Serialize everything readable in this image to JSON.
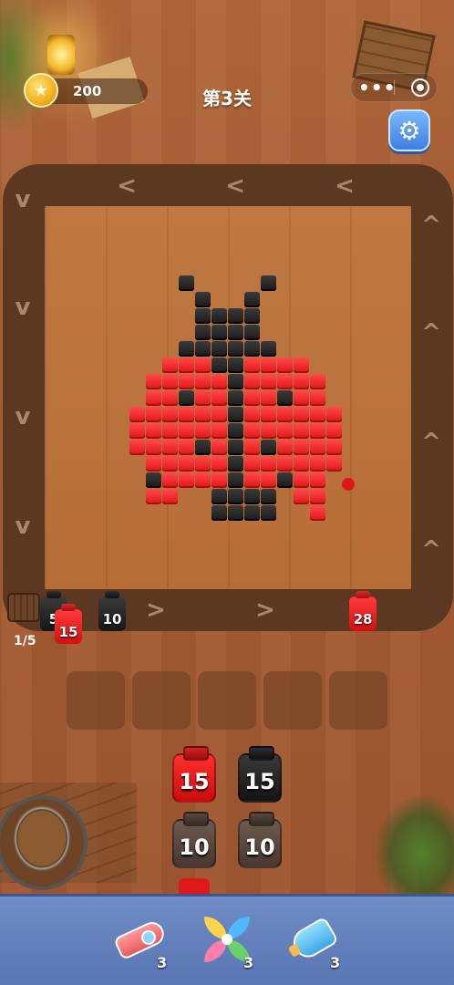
{
  "header": {
    "coins": "200",
    "level_title": "第3关",
    "more_label": "•••",
    "settings_icon": "⚙"
  },
  "conveyor": {
    "counter": "1/5",
    "jars_on_track": [
      {
        "value": "5",
        "color": "black"
      },
      {
        "value": "15",
        "color": "red"
      },
      {
        "value": "10",
        "color": "black"
      },
      {
        "value": "28",
        "color": "red"
      }
    ],
    "arrow_left": "<",
    "arrow_right": ">",
    "arrow_up": "^",
    "arrow_down": "v"
  },
  "empty_slots": 5,
  "queue": [
    {
      "value": "15",
      "color": "red"
    },
    {
      "value": "15",
      "color": "black"
    },
    {
      "value": "10",
      "color": "brown"
    },
    {
      "value": "10",
      "color": "brown"
    }
  ],
  "tools": [
    {
      "name": "rocket",
      "count": "3"
    },
    {
      "name": "pinwheel",
      "count": "3"
    },
    {
      "name": "bottle",
      "count": "3"
    }
  ],
  "colors": {
    "red": "#e01515",
    "black": "#1a1a1a",
    "board": "#b66d38",
    "track": "#5c3722",
    "bottom_bar": "#6f8cc6"
  },
  "ladybug_pattern": {
    "cols": 15,
    "rows": 15,
    "legend": {
      "r": "red",
      "b": "black",
      ".": "empty"
    },
    "rows_data": [
      "....b....b.....",
      ".....b..b......",
      ".....bbbb......",
      ".....bbbb......",
      "....bbbbbb.....",
      "...rrrbbrrrr...",
      "..rrrrrbrrrrr..",
      "..rrbrrbrrbrr..",
      ".rrrrrrbrrrrrr.",
      ".rrrrrrbrrrrrr.",
      ".rrrrbrbrbrrrr.",
      "..rrrrrbrrrrrr.",
      "..brrrrbrrbrr..",
      "..rr..bbbb.rr..",
      "......bbbb..r.."
    ]
  }
}
